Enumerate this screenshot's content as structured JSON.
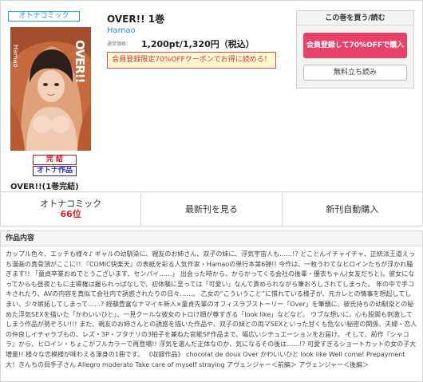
{
  "genre_tag": "オトナコミック",
  "cover": {
    "title_text": "OVER!!",
    "author_text": "Hamao"
  },
  "badges": {
    "complete": "完 結",
    "otona": "オトナ作品"
  },
  "volume_label": "OVER!!(1巻完結)",
  "book": {
    "title": "OVER!! 1巻",
    "author": "Hamao",
    "price_label": "通常価格：",
    "price": "1,200pt/1,320円（税込）",
    "coupon": "会員登録限定70%OFFクーポンでお得に読める！"
  },
  "buy_panel": {
    "header": "この巻を買う/読む",
    "buy_button": "会員登録して70%OFFで購入",
    "trial_button": "無料立ち読み"
  },
  "actions": {
    "rank_label": "オトナコミック",
    "rank_value": "66位",
    "latest": "最新刊を見る",
    "auto_purchase": "新刊自動購入"
  },
  "content": {
    "heading": "作品内容",
    "body": "カップル色々、エッチも様々♪ ギャルの幼馴染に、親友のお姉さん、双子の妹に、浮気宇宙人も……!? とことんイチャイチャ、正統派王道えっち漫画の真骨頂がここに!! 『COMIC快楽天』の表紙を彩る人気作家・Hamaoの単行本第6弾!! 今作は、一枚うわてなヒロインたちが浮かれ騒ぎます!! 「童貞卒業おめでとうございます、センパイ……」 出会った時から、からかってくる会社の後輩・優衣ちゃん(女友だちと)。彼女になってからも昼夜ともに主導権は握られっぱなしで、初体験に至っては「可愛い」なんて責められながら筆おろしされてしまった。 年の中で手コキされたり、AVの内容を真似て会社内で誘惑されたりの日々……。 乙女の“こういうこと”に慣れている様子が、元カレとの情事を想起してしまい、少々嫉妬してしまって……? 経験豊富なナマイキ新人×童貞先輩のオフィスラブストーリー「Over」を筆頭に、彼氏持ちの幼馴染との秘めた浮気SEXを描いた「かわいいひと」、一見クールな彼女のトロけ顔が尊すぎる「look like」などなど。 ウブな想いに、心も股間も刺激してしまう作品が勢ぞろい!!! また、親友のお姉さんとの誘惑を描いた作品や、双子の妹との両マSEXといった甘くも危ない秘密の関係、夫婦・恋人の仲良しイチャラブもの、レズ・3P・フタナリの3拍子を兼ねた官能SF作品まで、幅広いシチュエーションをお届け。 そして、前作『シャコラ』から、ヒロイン・ちょこがフルカラーで再登場!! 浮気を選んだ正体なのか、気になるその後は……!? 可愛すぎるショートカットの女の子大増量!! 様々な恋模様が味わえる渾身の1冊です。 《収録作品》 chocolat de doux Over かわいいひと look like Well come! Prepayment 大！きんちの目手子さん Allegro moderato Take care of myself straying アヴェンジャー＜前編＞ アヴェンジャー＜後編＞"
  },
  "colors": {
    "accent_blue": "#2a9ad8",
    "buy_pink": "#e8426b",
    "rank_red": "#d0242e",
    "coupon_bg": "#fff8d0"
  }
}
